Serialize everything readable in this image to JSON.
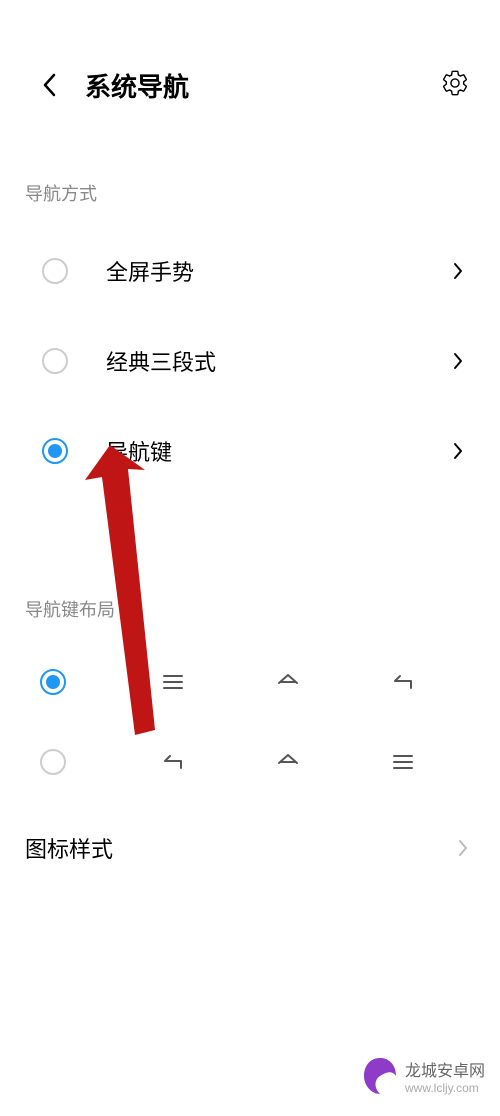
{
  "header": {
    "title": "系统导航"
  },
  "sections": {
    "navMethod": {
      "label": "导航方式"
    },
    "navKeyLayout": {
      "label": "导航键布局"
    }
  },
  "navOptions": [
    {
      "label": "全屏手势",
      "selected": false
    },
    {
      "label": "经典三段式",
      "selected": false
    },
    {
      "label": "导航键",
      "selected": true
    }
  ],
  "layoutOptions": [
    {
      "selected": true
    },
    {
      "selected": false
    }
  ],
  "iconStyle": {
    "label": "图标样式"
  },
  "watermark": {
    "title": "龙城安卓网",
    "url": "www.lcljy.com"
  }
}
